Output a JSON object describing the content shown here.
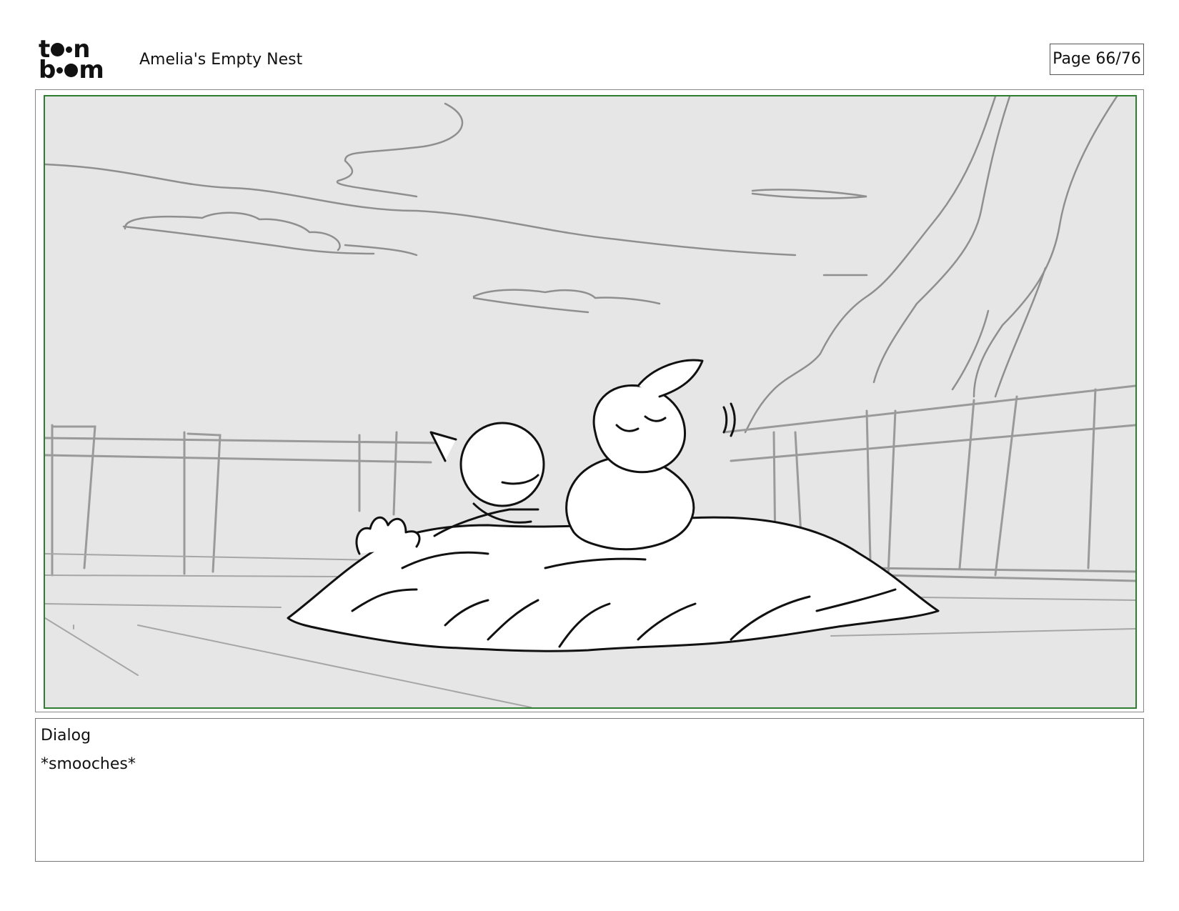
{
  "header": {
    "logo_brand": "toon boom",
    "title": "Amelia's Empty Nest",
    "page": "Page 66/76"
  },
  "panel": {
    "frame_color": "#2e7d32",
    "background_color": "#e6e6e6"
  },
  "dialog": {
    "label": "Dialog",
    "text": "*smooches*"
  }
}
